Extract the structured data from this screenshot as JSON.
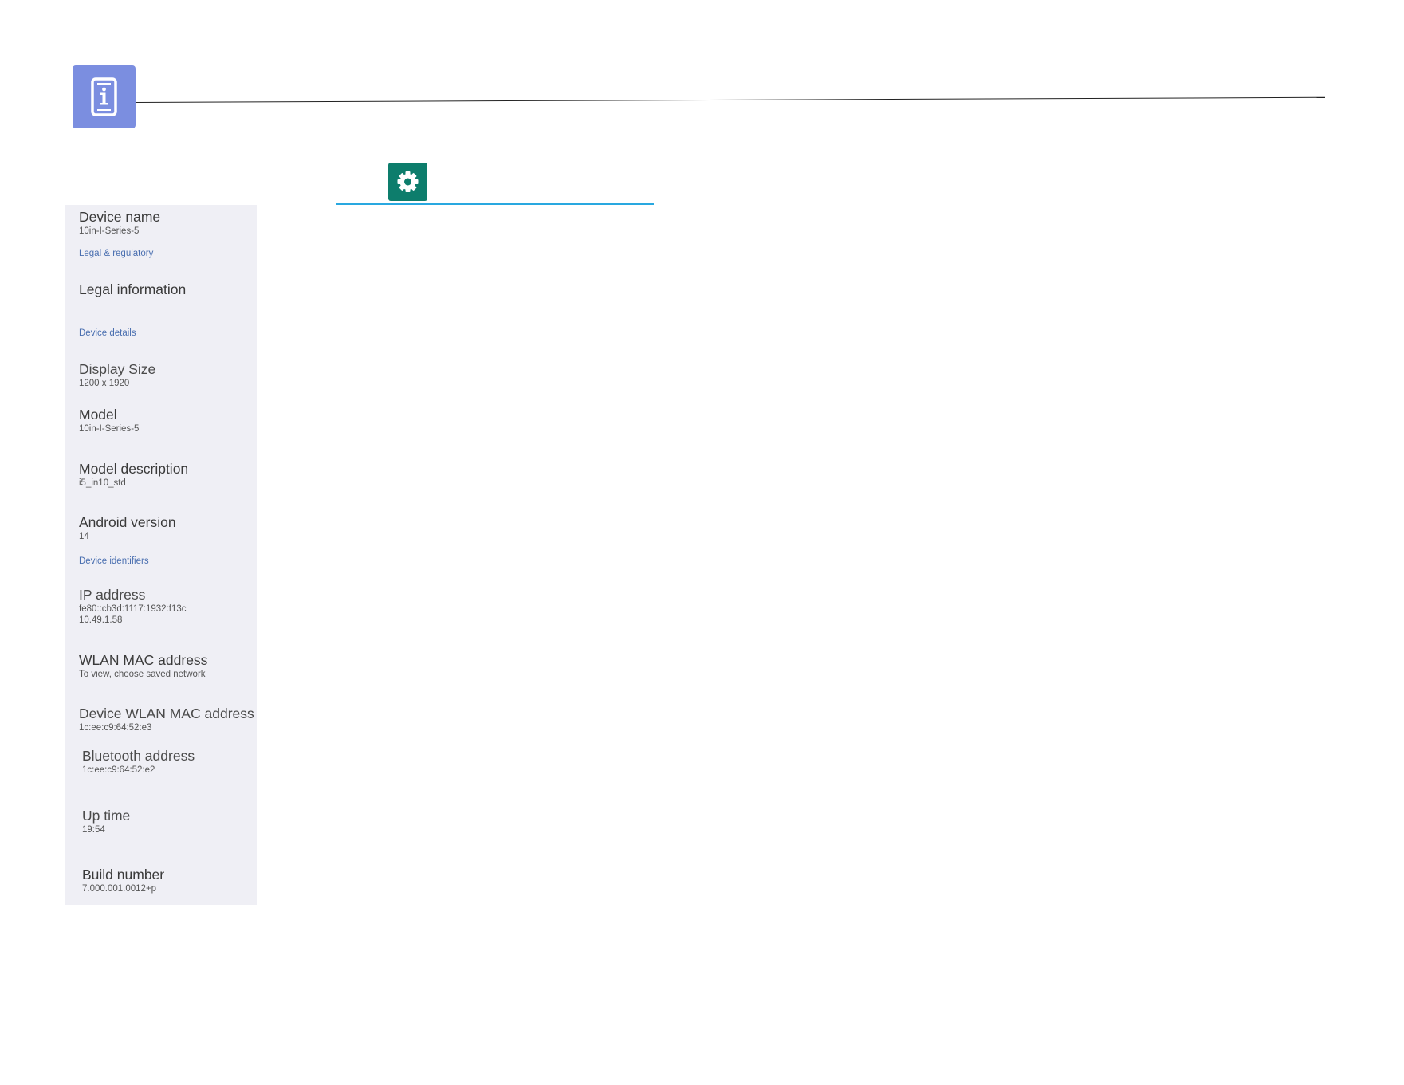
{
  "header": {
    "info_icon": "device-info-icon",
    "settings_icon": "gear-icon",
    "colors": {
      "info_icon_bg": "#7b8ee0",
      "settings_icon_bg": "#0d7d6c",
      "underline": "#29a8e0",
      "panel_bg": "#efeff5",
      "section_label": "#4a6fb0"
    }
  },
  "about": {
    "device_name": {
      "title": "Device name",
      "value": "10in-I-Series-5"
    },
    "legal_section": "Legal & regulatory",
    "legal_information": {
      "title": "Legal information"
    },
    "details_section": "Device details",
    "display_size": {
      "title": "Display Size",
      "value": "1200 x 1920"
    },
    "model": {
      "title": "Model",
      "value": "10in-I-Series-5"
    },
    "model_description": {
      "title": "Model description",
      "value": "i5_in10_std"
    },
    "android_version": {
      "title": "Android version",
      "value": "14"
    },
    "identifiers_section": "Device identifiers",
    "ip_address": {
      "title": "IP address",
      "value_line1": "fe80::cb3d:1117:1932:f13c",
      "value_line2": "10.49.1.58"
    },
    "wlan_mac": {
      "title": "WLAN MAC address",
      "value": "To view, choose saved network"
    },
    "device_wlan_mac": {
      "title": "Device WLAN MAC address",
      "value": "1c:ee:c9:64:52:e3"
    },
    "bluetooth_address": {
      "title": "Bluetooth address",
      "value": "1c:ee:c9:64:52:e2"
    },
    "up_time": {
      "title": "Up time",
      "value": "19:54"
    },
    "build_number": {
      "title": "Build number",
      "value": "7.000.001.0012+p"
    }
  }
}
